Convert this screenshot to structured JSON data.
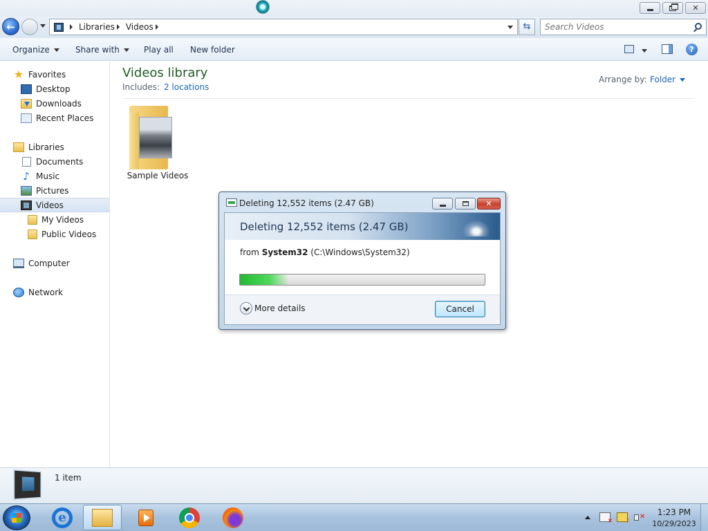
{
  "window": {
    "min_label": "",
    "max_label": "",
    "close_label": ""
  },
  "address": {
    "breadcrumbs": [
      "Libraries",
      "Videos"
    ]
  },
  "search": {
    "placeholder": "Search Videos"
  },
  "toolbar": {
    "organize": "Organize",
    "share_with": "Share with",
    "play_all": "Play all",
    "new_folder": "New folder"
  },
  "sidebar": {
    "items": [
      {
        "label": "Favorites",
        "icon": "star-icon"
      },
      {
        "label": "Desktop",
        "icon": "desktop-icon"
      },
      {
        "label": "Downloads",
        "icon": "downloads-icon"
      },
      {
        "label": "Recent Places",
        "icon": "recent-places-icon"
      },
      {
        "label": "Libraries",
        "icon": "libraries-icon"
      },
      {
        "label": "Documents",
        "icon": "documents-icon"
      },
      {
        "label": "Music",
        "icon": "music-icon"
      },
      {
        "label": "Pictures",
        "icon": "pictures-icon"
      },
      {
        "label": "Videos",
        "icon": "videos-icon",
        "selected": true
      },
      {
        "label": "My Videos",
        "icon": "folder-icon"
      },
      {
        "label": "Public Videos",
        "icon": "folder-icon"
      },
      {
        "label": "Computer",
        "icon": "computer-icon"
      },
      {
        "label": "Network",
        "icon": "network-icon"
      }
    ]
  },
  "library": {
    "title": "Videos library",
    "includes_label": "Includes:",
    "locations_link": "2 locations",
    "arrange_label": "Arrange by:",
    "arrange_value": "Folder"
  },
  "items": [
    {
      "name": "Sample Videos",
      "icon": "folder-thumbnail-icon"
    }
  ],
  "details": {
    "count": "1 item"
  },
  "dialog": {
    "title": "Deleting 12,552 items (2.47 GB)",
    "heading": "Deleting 12,552 items (2.47 GB)",
    "from_prefix": "from",
    "from_name": "System32",
    "from_path": "(C:\\Windows\\System32)",
    "progress": 0.2,
    "more_details": "More details",
    "cancel": "Cancel"
  },
  "taskbar": {
    "apps": [
      "internet-explorer-icon",
      "windows-explorer-icon",
      "media-center-icon",
      "chrome-icon",
      "firefox-icon"
    ],
    "clock_time": "1:23 PM",
    "clock_date": "10/29/2023"
  }
}
